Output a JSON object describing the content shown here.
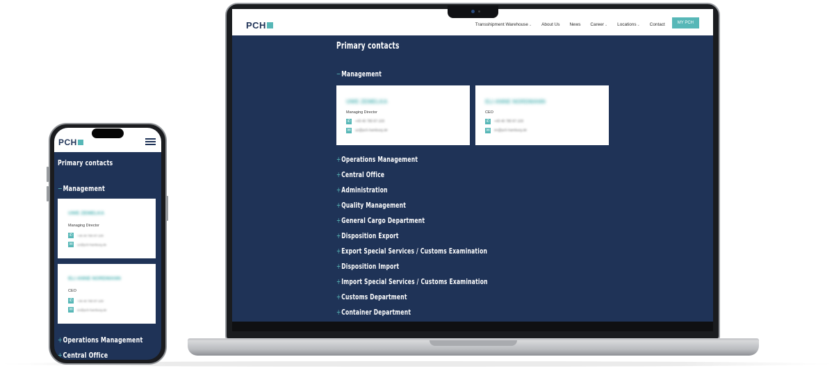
{
  "site": {
    "logo_text": "PCH",
    "accent_color": "#57b7b7",
    "background_color": "#1f3357"
  },
  "nav": {
    "items": [
      {
        "label": "Transshipment Warehouse",
        "dropdown": true
      },
      {
        "label": "About Us",
        "dropdown": false
      },
      {
        "label": "News",
        "dropdown": false
      },
      {
        "label": "Career",
        "dropdown": true
      },
      {
        "label": "Locations",
        "dropdown": true
      },
      {
        "label": "Contact",
        "dropdown": false
      }
    ],
    "cta_label": "MY PCH"
  },
  "page": {
    "title": "Primary contacts",
    "expanded_section": {
      "sign": "−",
      "label": "Management",
      "contacts": [
        {
          "name": "UWE ZEMELKA",
          "role": "Managing Director",
          "phone": "+49 40 780 87-100",
          "email": "uz@pch-hamburg.de"
        },
        {
          "name": "ELI ANNE NORDMANN",
          "role": "CEO",
          "phone": "+49 40 780 87-100",
          "email": "en@pch-hamburg.de"
        }
      ]
    },
    "collapsed_sign": "+",
    "collapsed_sections": [
      "Operations Management",
      "Central Office",
      "Administration",
      "Quality Management",
      "General Cargo Department",
      "Disposition Export",
      "Export Special Services / Customs Examination",
      "Disposition Import",
      "Import Special Services / Customs Examination",
      "Customs Department",
      "Container Department"
    ]
  },
  "icons": {
    "phone": "phone-icon",
    "email": "email-icon",
    "menu": "hamburger-menu-icon",
    "chevron": "chevron-down-icon"
  }
}
